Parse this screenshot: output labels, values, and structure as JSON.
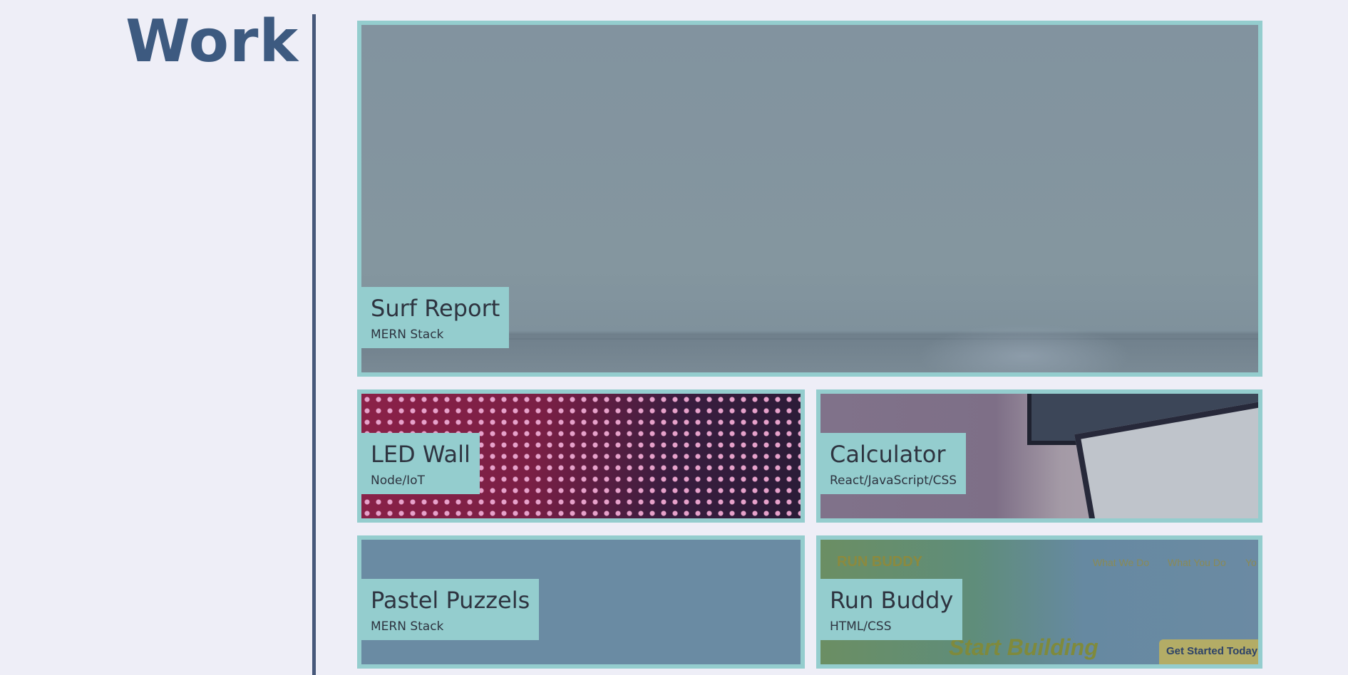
{
  "section": {
    "title": "Work"
  },
  "projects": [
    {
      "title": "Surf Report",
      "stack": "MERN Stack"
    },
    {
      "title": "LED Wall",
      "stack": "Node/IoT"
    },
    {
      "title": "Calculator",
      "stack": "React/JavaScript/CSS"
    },
    {
      "title": "Pastel Puzzels",
      "stack": "MERN Stack"
    },
    {
      "title": "Run Buddy",
      "stack": "HTML/CSS",
      "preview": {
        "logo": "RUN BUDDY",
        "nav": [
          "What We Do",
          "What You Do",
          "Yo"
        ],
        "hero": "Start Building",
        "cta": "Get Started Today"
      }
    }
  ],
  "colors": {
    "background": "#eeeef7",
    "accent": "#94cdce",
    "title": "#3d5a80",
    "divider": "#46587a"
  }
}
